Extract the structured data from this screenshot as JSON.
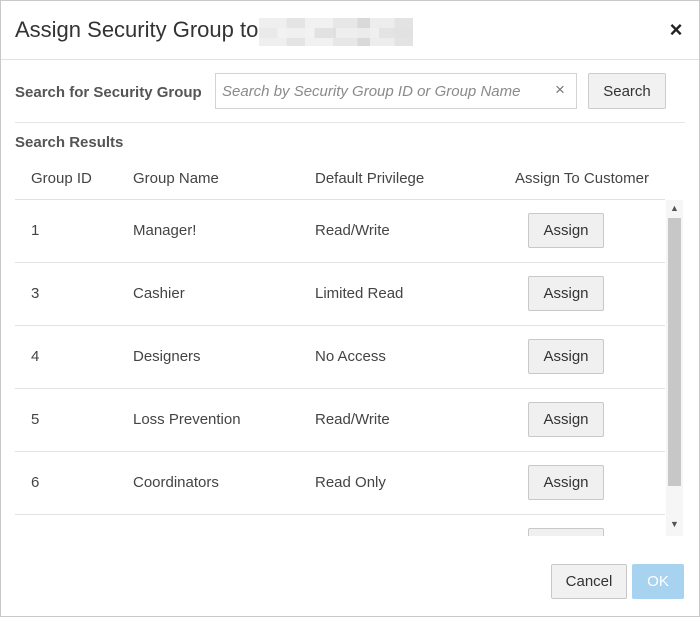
{
  "dialog": {
    "title": "Assign Security Group to",
    "close_glyph": "×",
    "close_icon": "close-icon"
  },
  "search": {
    "label": "Search for Security Group",
    "value": "",
    "placeholder": "Search by Security Group ID or Group Name",
    "clear_glyph": "×",
    "button_label": "Search"
  },
  "results": {
    "label": "Search Results",
    "columns": [
      "Group ID",
      "Group Name",
      "Default Privilege",
      "Assign To Customer"
    ],
    "rows": [
      {
        "id": "1",
        "name": "Manager!",
        "privilege": "Read/Write",
        "action": "Assign"
      },
      {
        "id": "3",
        "name": "Cashier",
        "privilege": "Limited Read",
        "action": "Assign"
      },
      {
        "id": "4",
        "name": "Designers",
        "privilege": "No Access",
        "action": "Assign"
      },
      {
        "id": "5",
        "name": "Loss Prevention",
        "privilege": "Read/Write",
        "action": "Assign"
      },
      {
        "id": "6",
        "name": "Coordinators",
        "privilege": "Read Only",
        "action": "Assign"
      },
      {
        "id": "",
        "name": "",
        "privilege": "",
        "action": ""
      }
    ]
  },
  "scrollbar": {
    "up_glyph": "▲",
    "down_glyph": "▼"
  },
  "footer": {
    "cancel_label": "Cancel",
    "ok_label": "OK"
  },
  "colors": {
    "ok_button_bg": "#a7d2f0",
    "button_bg": "#f0f0f0",
    "border": "#c8c8c8"
  }
}
